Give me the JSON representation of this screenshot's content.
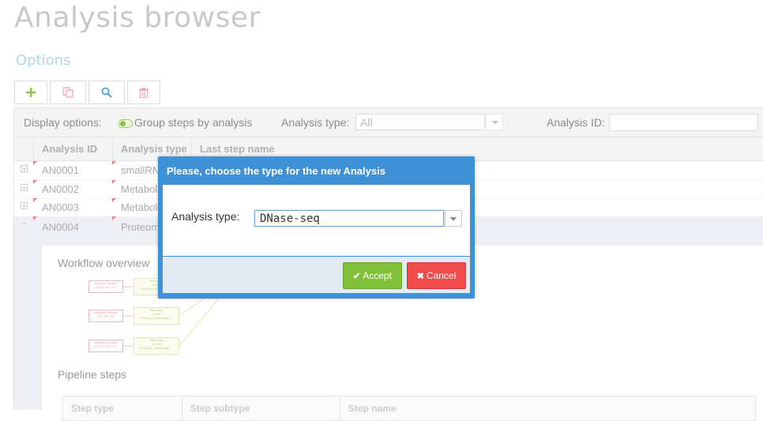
{
  "page": {
    "title": "Analysis browser",
    "options_title": "Options"
  },
  "toolbar": {
    "buttons": [
      {
        "icon": "plus-icon",
        "color": "#8bc34a"
      },
      {
        "icon": "copy-icon",
        "color": "#f4a6b8"
      },
      {
        "icon": "search-icon",
        "color": "#4aa3df"
      },
      {
        "icon": "trash-icon",
        "color": "#f4a6b8"
      }
    ]
  },
  "options_bar": {
    "display_label": "Display options:",
    "group_label": "Group steps by analysis",
    "analysis_type_label": "Analysis type:",
    "analysis_type_value": "All",
    "analysis_id_label": "Analysis ID:"
  },
  "grid": {
    "columns": [
      "Analysis ID",
      "Analysis type",
      "Last step name"
    ],
    "rows": [
      {
        "id": "AN0001",
        "type": "smallRNA",
        "expander": "+"
      },
      {
        "id": "AN0002",
        "type": "Metabolo",
        "expander": "+"
      },
      {
        "id": "AN0003",
        "type": "Metabolo",
        "expander": "+"
      },
      {
        "id": "AN0004",
        "type": "Proteom",
        "expander": "−"
      }
    ]
  },
  "detail": {
    "workflow_title": "Workflow overview",
    "pipeline_title": "Pipeline steps",
    "step_columns": [
      "Step type",
      "Step subtype",
      "Step name"
    ],
    "nodes_red": [
      {
        "line1": "Analysis Sample",
        "line2": "AN?0?.?0?.?0?"
      },
      {
        "line1": "Analysis Sample",
        "line2": "?0?.?0?.?0?"
      },
      {
        "line1": "Analysis Sample",
        "line2": "AN?0?.?0?.?0?"
      }
    ],
    "nodes_green": [
      {
        "line1": "Raw data",
        "line2": "LC-MS",
        "line3": "STXXg's_Proteomics"
      },
      {
        "line1": "Raw data",
        "line2": "LC-MS",
        "line3": "STXXg's_Proteomics_..."
      },
      {
        "line1": "Raw data",
        "line2": "LC-MS",
        "line3": "STXXg's_Proteomics_..."
      }
    ]
  },
  "modal": {
    "title": "Please, choose the type for the new Analysis",
    "label": "Analysis type:",
    "selected_value": "DNase-seq",
    "accept_label": "Accept",
    "cancel_label": "Cancel",
    "colors": {
      "header": "#3e91d6",
      "accept": "#82c03a",
      "cancel": "#f04c4c"
    }
  }
}
